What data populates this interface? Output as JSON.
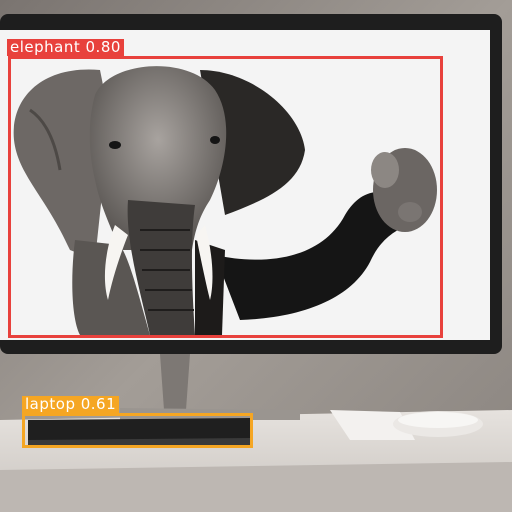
{
  "detections": [
    {
      "label": "elephant 0.80",
      "color": "#e8413c"
    },
    {
      "label": "laptop 0.61",
      "color": "#f5a623"
    }
  ],
  "scene_colors": {
    "wall": "#8f8a85",
    "desk": "#dcd7d3",
    "monitor_bezel": "#1e1e1e",
    "screen": "#f4f4f4"
  }
}
